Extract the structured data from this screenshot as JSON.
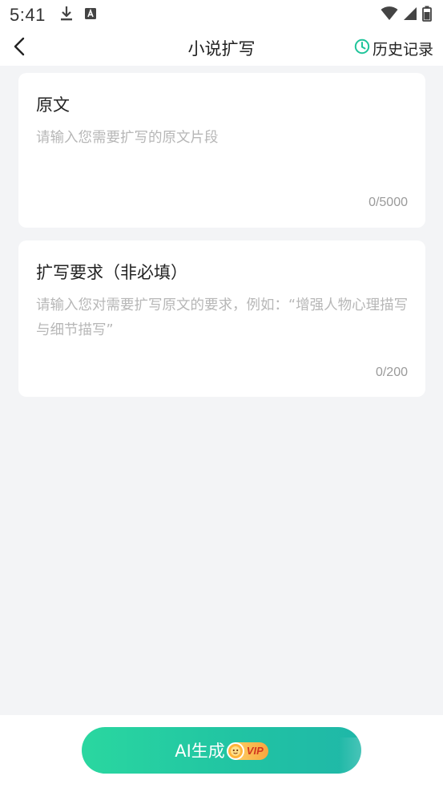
{
  "status_bar": {
    "time": "5:41",
    "icons": [
      "download-icon",
      "keyboard-app-icon",
      "wifi-icon",
      "signal-icon",
      "battery-icon"
    ]
  },
  "nav": {
    "title": "小说扩写",
    "history_label": "历史记录",
    "accent_color": "#1fc49a"
  },
  "original_card": {
    "title": "原文",
    "placeholder": "请输入您需要扩写的原文片段",
    "value": "",
    "counter": "0/5000"
  },
  "request_card": {
    "title": "扩写要求（非必填）",
    "placeholder": "请输入您对需要扩写原文的要求，例如：“增强人物心理描写与细节描写”",
    "value": "",
    "counter": "0/200"
  },
  "generate": {
    "label": "AI生成",
    "badge": "VIP",
    "button_color": "#22c9a2"
  }
}
